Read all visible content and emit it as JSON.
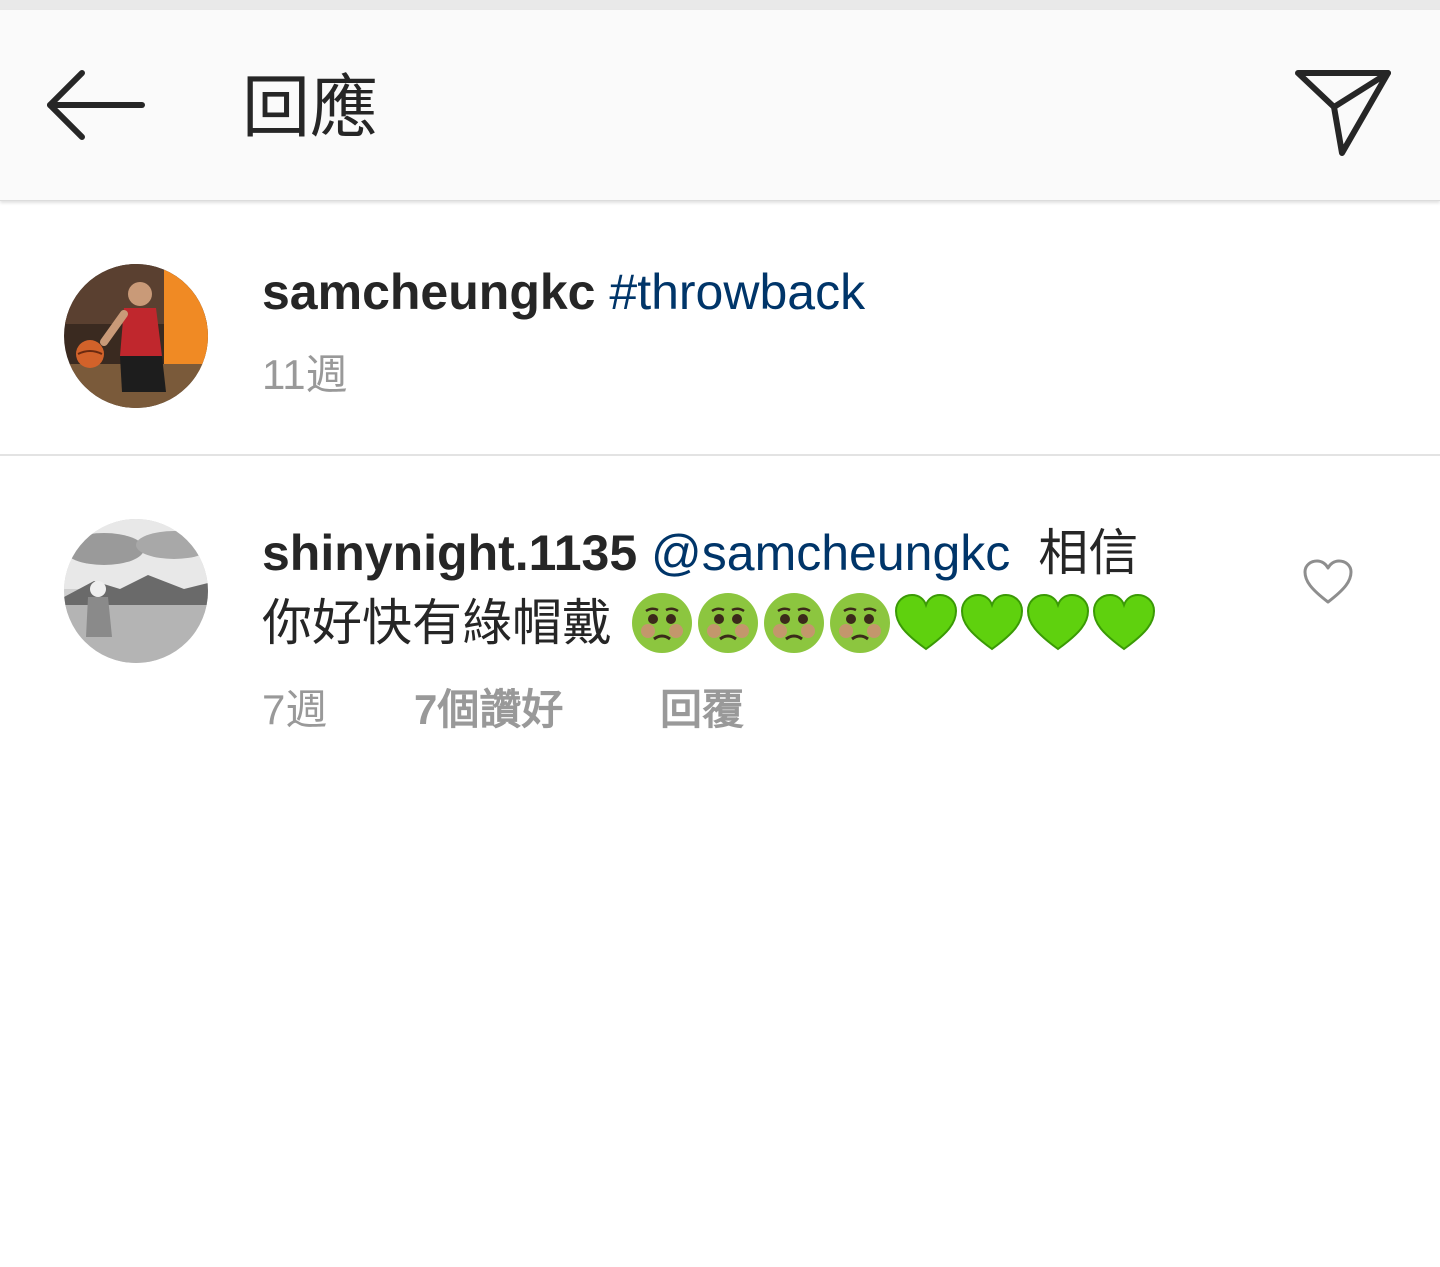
{
  "header": {
    "title": "回應",
    "back_icon": "arrow-left-icon",
    "send_icon": "paper-plane-icon"
  },
  "caption": {
    "username": "samcheungkc",
    "hashtag": "#throwback",
    "time": "11週",
    "avatar": "basketball-player-photo"
  },
  "comment": {
    "username": "shinynight.1135",
    "mention": "@samcheungkc",
    "text_line1": "相信",
    "text_line2": "你好快有綠帽戴",
    "emojis": [
      "nauseated-face",
      "nauseated-face",
      "nauseated-face",
      "nauseated-face",
      "green-heart",
      "green-heart",
      "green-heart",
      "green-heart"
    ],
    "time": "7週",
    "likes": "7個讚好",
    "reply": "回覆",
    "avatar": "monochrome-coastline-photo"
  },
  "colors": {
    "link": "#003569",
    "text": "#262626",
    "meta": "#999999",
    "header_bg": "#fafafa",
    "emoji_green": "#5fd10e"
  }
}
